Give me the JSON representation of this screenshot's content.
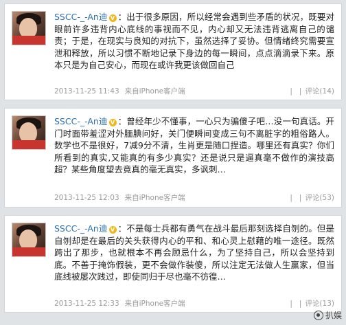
{
  "posts": [
    {
      "username": "SSCC-_-An迪",
      "badge": "V",
      "colon": "：",
      "text": "出于很多原因，所以经常会遇到些矛盾的状况，既要对眼前许多违背内心底线的事视而不见，内心却又无法违背逃离自己的谴责；于是，在现实与良知的对抗下，虽然选择了妥协。但情绪终究需要宣泄和释放，所以习惯不断地记录下身边的每一瞬间，点点滴滴录下来。原本只是为自己安心，而现在或许我更该做回自己",
      "time": "2013-11-25 11:43",
      "source": "来自iPhone客户端",
      "actions": [
        "",
        "",
        "评论(14)"
      ]
    },
    {
      "username": "SSCC-_-An迪",
      "badge": "V",
      "colon": "：",
      "text": "曾经年少不懂事，一心只为骗傻子吧…没一句真话。开门时面带羞涩对外腼腆问好，关门便瞬间变成三句不离脏字的粗俗路人。数学也不是很好，7减9分不清，生肖更是随口捏造。哪里还有真实？你们所看到的真实,又能真的有多少真实？还是说只是逼真毫不做作的演技高超？某些角度望去竟真的毫无真实，多讽刺…",
      "time": "2013-11-25 12:03",
      "source": "来自iPhone客户端",
      "actions": [
        "",
        "",
        "评论(53)"
      ]
    },
    {
      "username": "SSCC-_-An迪",
      "badge": "V",
      "colon": "：",
      "text": "不是每士兵都有勇气在战斗最后那刻选择自刎的。但是自刎却是在最后的关头获得内心的平和、和心灵上慰藉的唯一途径。既然跨出了那步，也就根本不再会顾忌什么，为了坚持自己，所以会坚持到底。不善于掩饰假装，更不会做作装傻，所以注定无法做人生赢家，但当底线被屡次践过，即使同归于尽也毫不彷徨…",
      "time": "2013-11-25 12:33",
      "source": "来自iPhone客户端",
      "actions": [
        "",
        "",
        "评论(13)"
      ]
    }
  ],
  "watermark": "扒娱"
}
